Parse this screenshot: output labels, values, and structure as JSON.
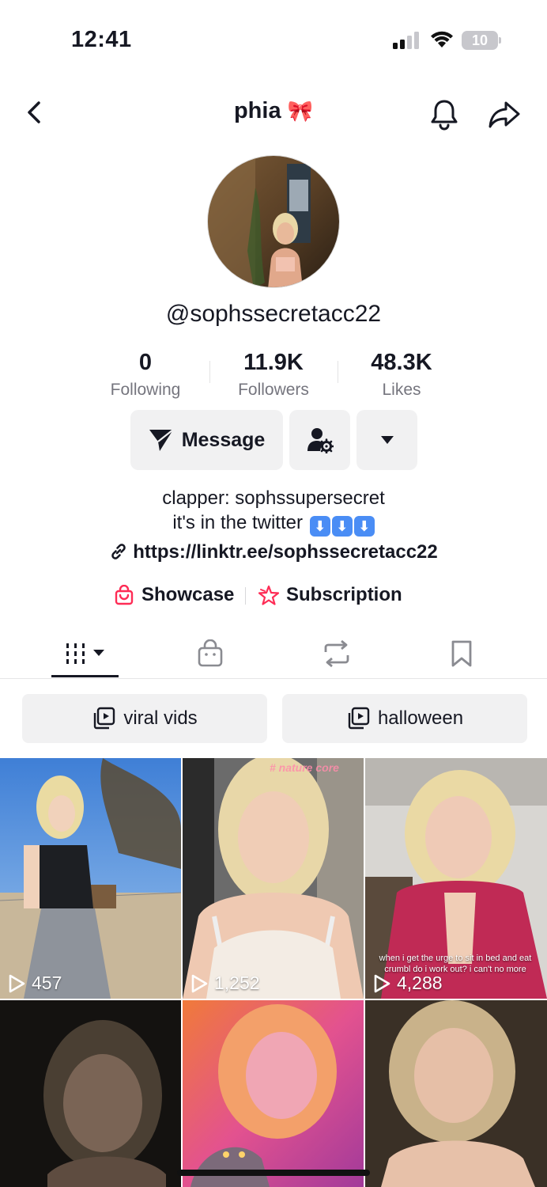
{
  "status_bar": {
    "time": "12:41",
    "battery": "10",
    "icons": [
      "signal-icon",
      "wifi-icon",
      "battery-icon"
    ]
  },
  "nav": {
    "title": "phia",
    "title_emoji": "🎀",
    "icons": [
      "back-icon",
      "bell-icon",
      "share-icon"
    ]
  },
  "profile": {
    "username": "@sophssecretacc22",
    "stats": [
      {
        "value": "0",
        "label": "Following"
      },
      {
        "value": "11.9K",
        "label": "Followers"
      },
      {
        "value": "48.3K",
        "label": "Likes"
      }
    ],
    "message_label": "Message",
    "bio_line1": "clapper: sophssupersecret",
    "bio_line2": "it's in the twitter",
    "bio_emoji": "⬇️",
    "link": "https://linktr.ee/sophssecretacc22",
    "showcase_label": "Showcase",
    "subscription_label": "Subscription"
  },
  "tabs": [
    "videos-grid-icon",
    "shop-bag-icon",
    "repost-icon",
    "bookmark-icon"
  ],
  "playlists": [
    {
      "label": "viral vids"
    },
    {
      "label": "halloween"
    }
  ],
  "videos": [
    {
      "views": "457"
    },
    {
      "views": "1,252",
      "overlay": "# nature core"
    },
    {
      "views": "4,288",
      "caption": "when i get the urge to sit in bed and eat crumbl do i work out? i can't no more"
    },
    {
      "views": ""
    },
    {
      "views": ""
    },
    {
      "views": ""
    }
  ],
  "colors": {
    "accent_pink": "#fe2c55",
    "button_bg": "#f1f1f2",
    "text_primary": "#161823",
    "text_secondary": "#75757e"
  }
}
